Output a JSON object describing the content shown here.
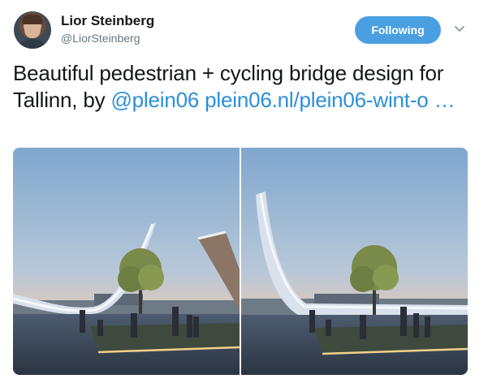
{
  "tweet": {
    "author": {
      "display_name": "Lior Steinberg",
      "handle": "@LiorSteinberg"
    },
    "follow_button_label": "Following",
    "text": {
      "plain": "Beautiful pedestrian + cycling bridge design for Tallinn, by ",
      "mention": "@plein06",
      "url": "plein06.nl/plein06-wint-o …"
    },
    "media": [
      {
        "icon": "bridge-render-photo-left"
      },
      {
        "icon": "bridge-render-photo-right"
      }
    ]
  },
  "colors": {
    "accent": "#4a9fe0",
    "link": "#2b8fd8",
    "text": "#14171a",
    "muted": "#657786"
  }
}
